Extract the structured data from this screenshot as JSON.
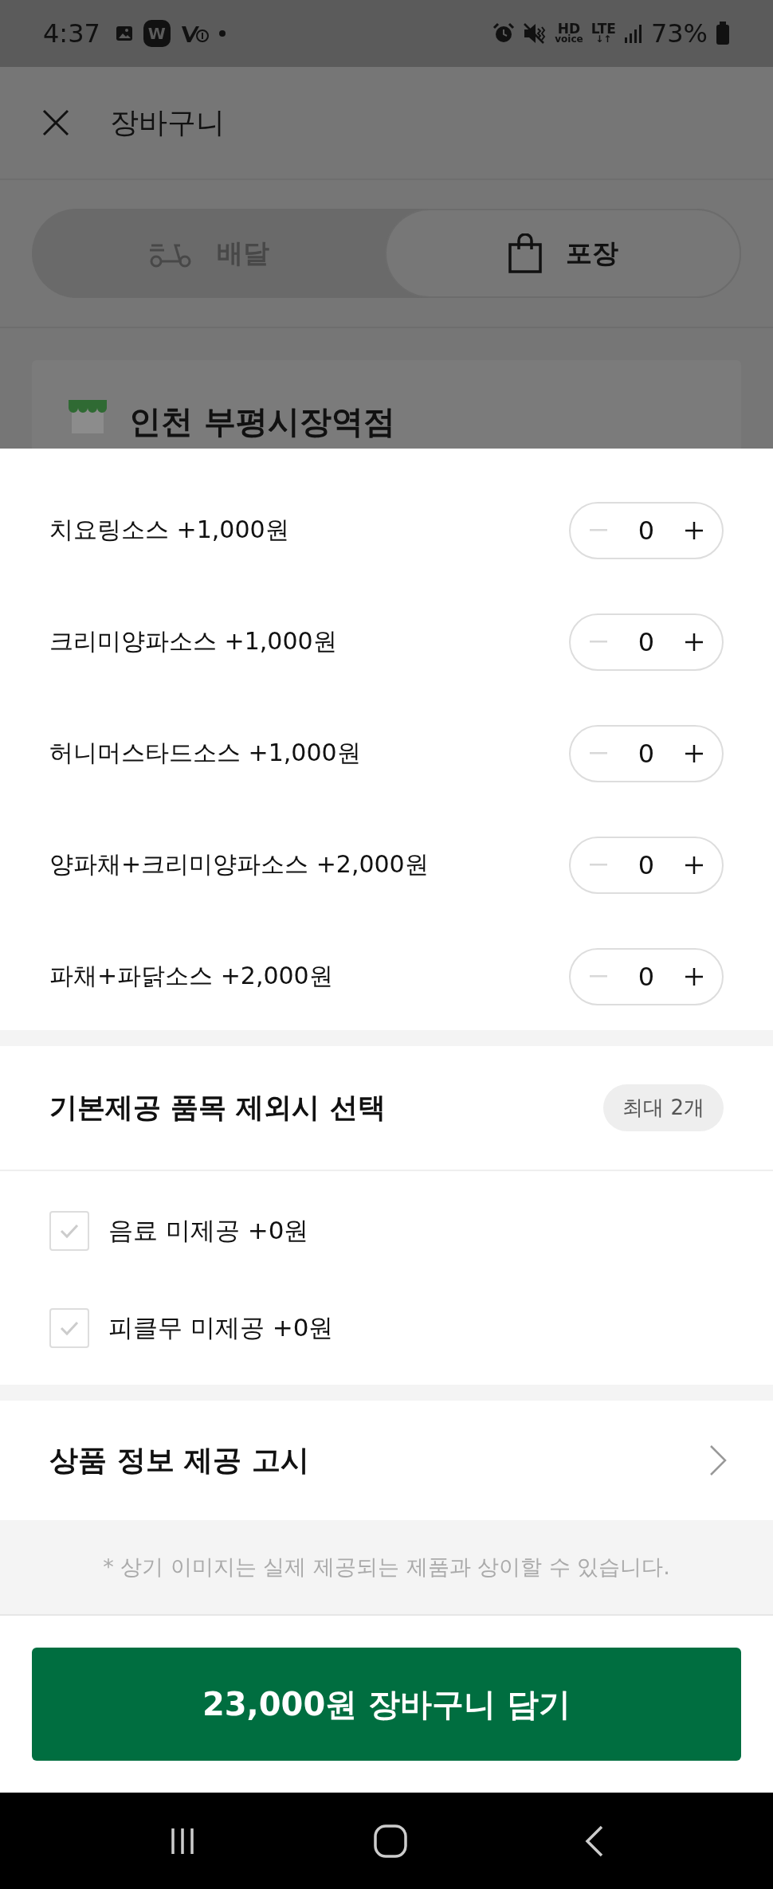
{
  "status_bar": {
    "time": "4:37",
    "app_badge": "W",
    "hd_label": "HD",
    "voice_label": "voice",
    "lte_label": "LTE",
    "lte_arrows": "↓↑",
    "battery": "73%"
  },
  "header": {
    "title": "장바구니"
  },
  "order_type_tabs": [
    {
      "label": "배달",
      "kind": "delivery",
      "selected": false
    },
    {
      "label": "포장",
      "kind": "pickup",
      "selected": true
    }
  ],
  "store": {
    "name": "인천 부평시장역점"
  },
  "sauce_options": [
    {
      "label": "치요링소스 +1,000원",
      "count": "0",
      "minus_disabled": true
    },
    {
      "label": "크리미양파소스 +1,000원",
      "count": "0",
      "minus_disabled": true
    },
    {
      "label": "허니머스타드소스 +1,000원",
      "count": "0",
      "minus_disabled": true
    },
    {
      "label": "양파채+크리미양파소스 +2,000원",
      "count": "0",
      "minus_disabled": true
    },
    {
      "label": "파채+파닭소스 +2,000원",
      "count": "0",
      "minus_disabled": true
    }
  ],
  "exclusion_section": {
    "title": "기본제공 품목 제외시 선택",
    "limit_badge": "최대 2개",
    "items": [
      {
        "label": "음료 미제공 +0원",
        "checked": false
      },
      {
        "label": "피클무 미제공 +0원",
        "checked": false
      }
    ]
  },
  "product_info_link": "상품 정보 제공 고시",
  "disclaimer": "* 상기 이미지는 실제 제공되는 제품과 상이할 수 있습니다.",
  "add_to_cart_button": "23,000원 장바구니 담기"
}
